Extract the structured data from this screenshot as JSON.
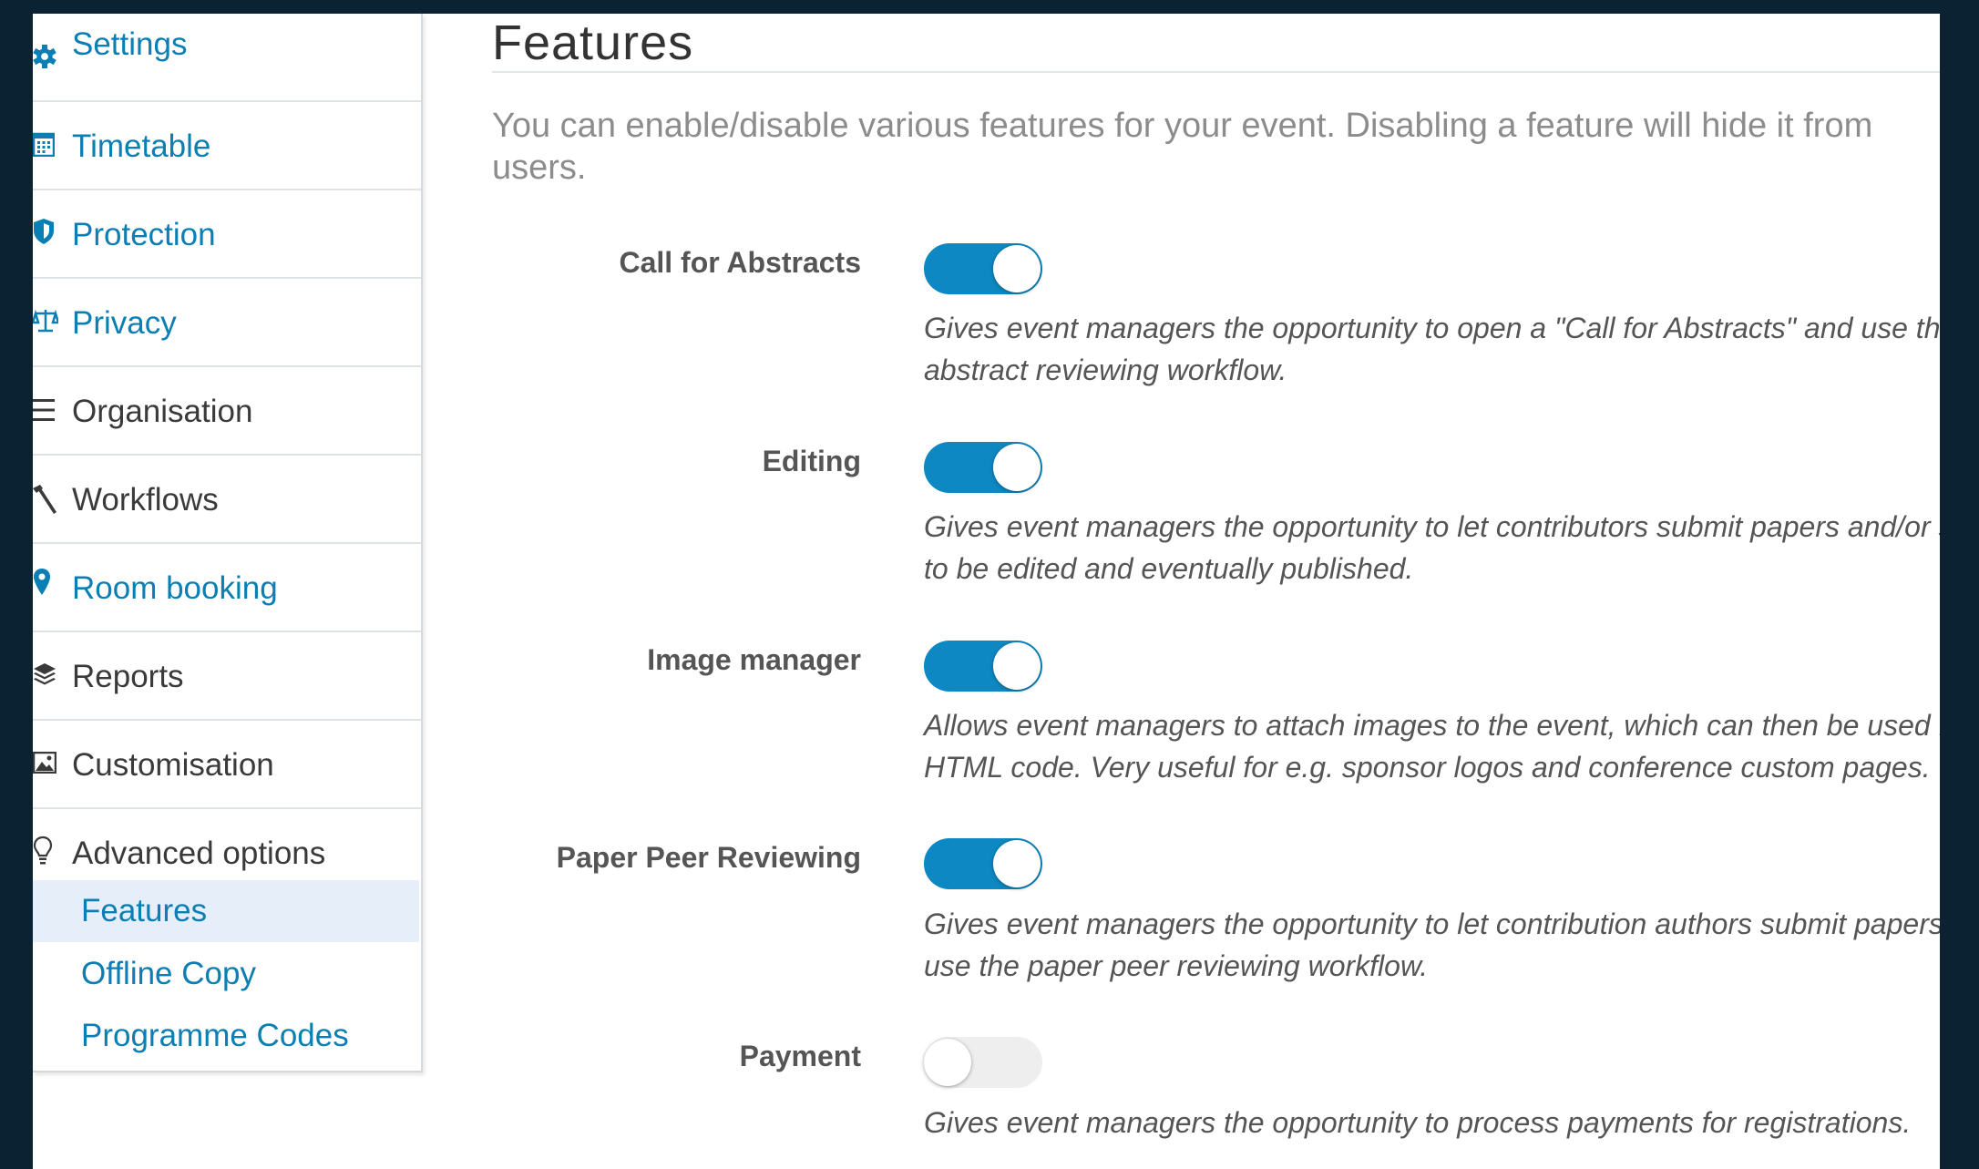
{
  "sidebar": {
    "items": [
      {
        "label": "Settings",
        "icon": "gear-icon"
      },
      {
        "label": "Timetable",
        "icon": "calendar-icon"
      },
      {
        "label": "Protection",
        "icon": "shield-icon"
      },
      {
        "label": "Privacy",
        "icon": "scales-icon"
      },
      {
        "label": "Organisation",
        "icon": "list-icon"
      },
      {
        "label": "Workflows",
        "icon": "hammer-icon"
      },
      {
        "label": "Room booking",
        "icon": "map-pin-icon"
      },
      {
        "label": "Reports",
        "icon": "layers-icon"
      },
      {
        "label": "Customisation",
        "icon": "image-icon"
      },
      {
        "label": "Advanced options",
        "icon": "lightbulb-icon"
      }
    ],
    "subitems": [
      {
        "label": "Features",
        "active": true
      },
      {
        "label": "Offline Copy",
        "active": false
      },
      {
        "label": "Programme Codes",
        "active": false
      }
    ]
  },
  "main": {
    "title": "Features",
    "intro": "You can enable/disable various features for your event. Disabling a feature will hide it from users.",
    "features": [
      {
        "label": "Call for Abstracts",
        "enabled": true,
        "description": "Gives event managers the opportunity to open a \"Call for Abstracts\" and use the abstract reviewing workflow."
      },
      {
        "label": "Editing",
        "enabled": true,
        "description": "Gives event managers the opportunity to let contributors submit papers and/or s to be edited and eventually published."
      },
      {
        "label": "Image manager",
        "enabled": true,
        "description": "Allows event managers to attach images to the event, which can then be used f HTML code. Very useful for e.g. sponsor logos and conference custom pages."
      },
      {
        "label": "Paper Peer Reviewing",
        "enabled": true,
        "description": "Gives event managers the opportunity to let contribution authors submit papers use the paper peer reviewing workflow."
      },
      {
        "label": "Payment",
        "enabled": false,
        "description": "Gives event managers the opportunity to process payments for registrations."
      }
    ]
  },
  "colors": {
    "accent": "#0e88c2",
    "link": "#0b7fb4",
    "active_bg": "#e6eefa",
    "frame": "#0b2233"
  }
}
